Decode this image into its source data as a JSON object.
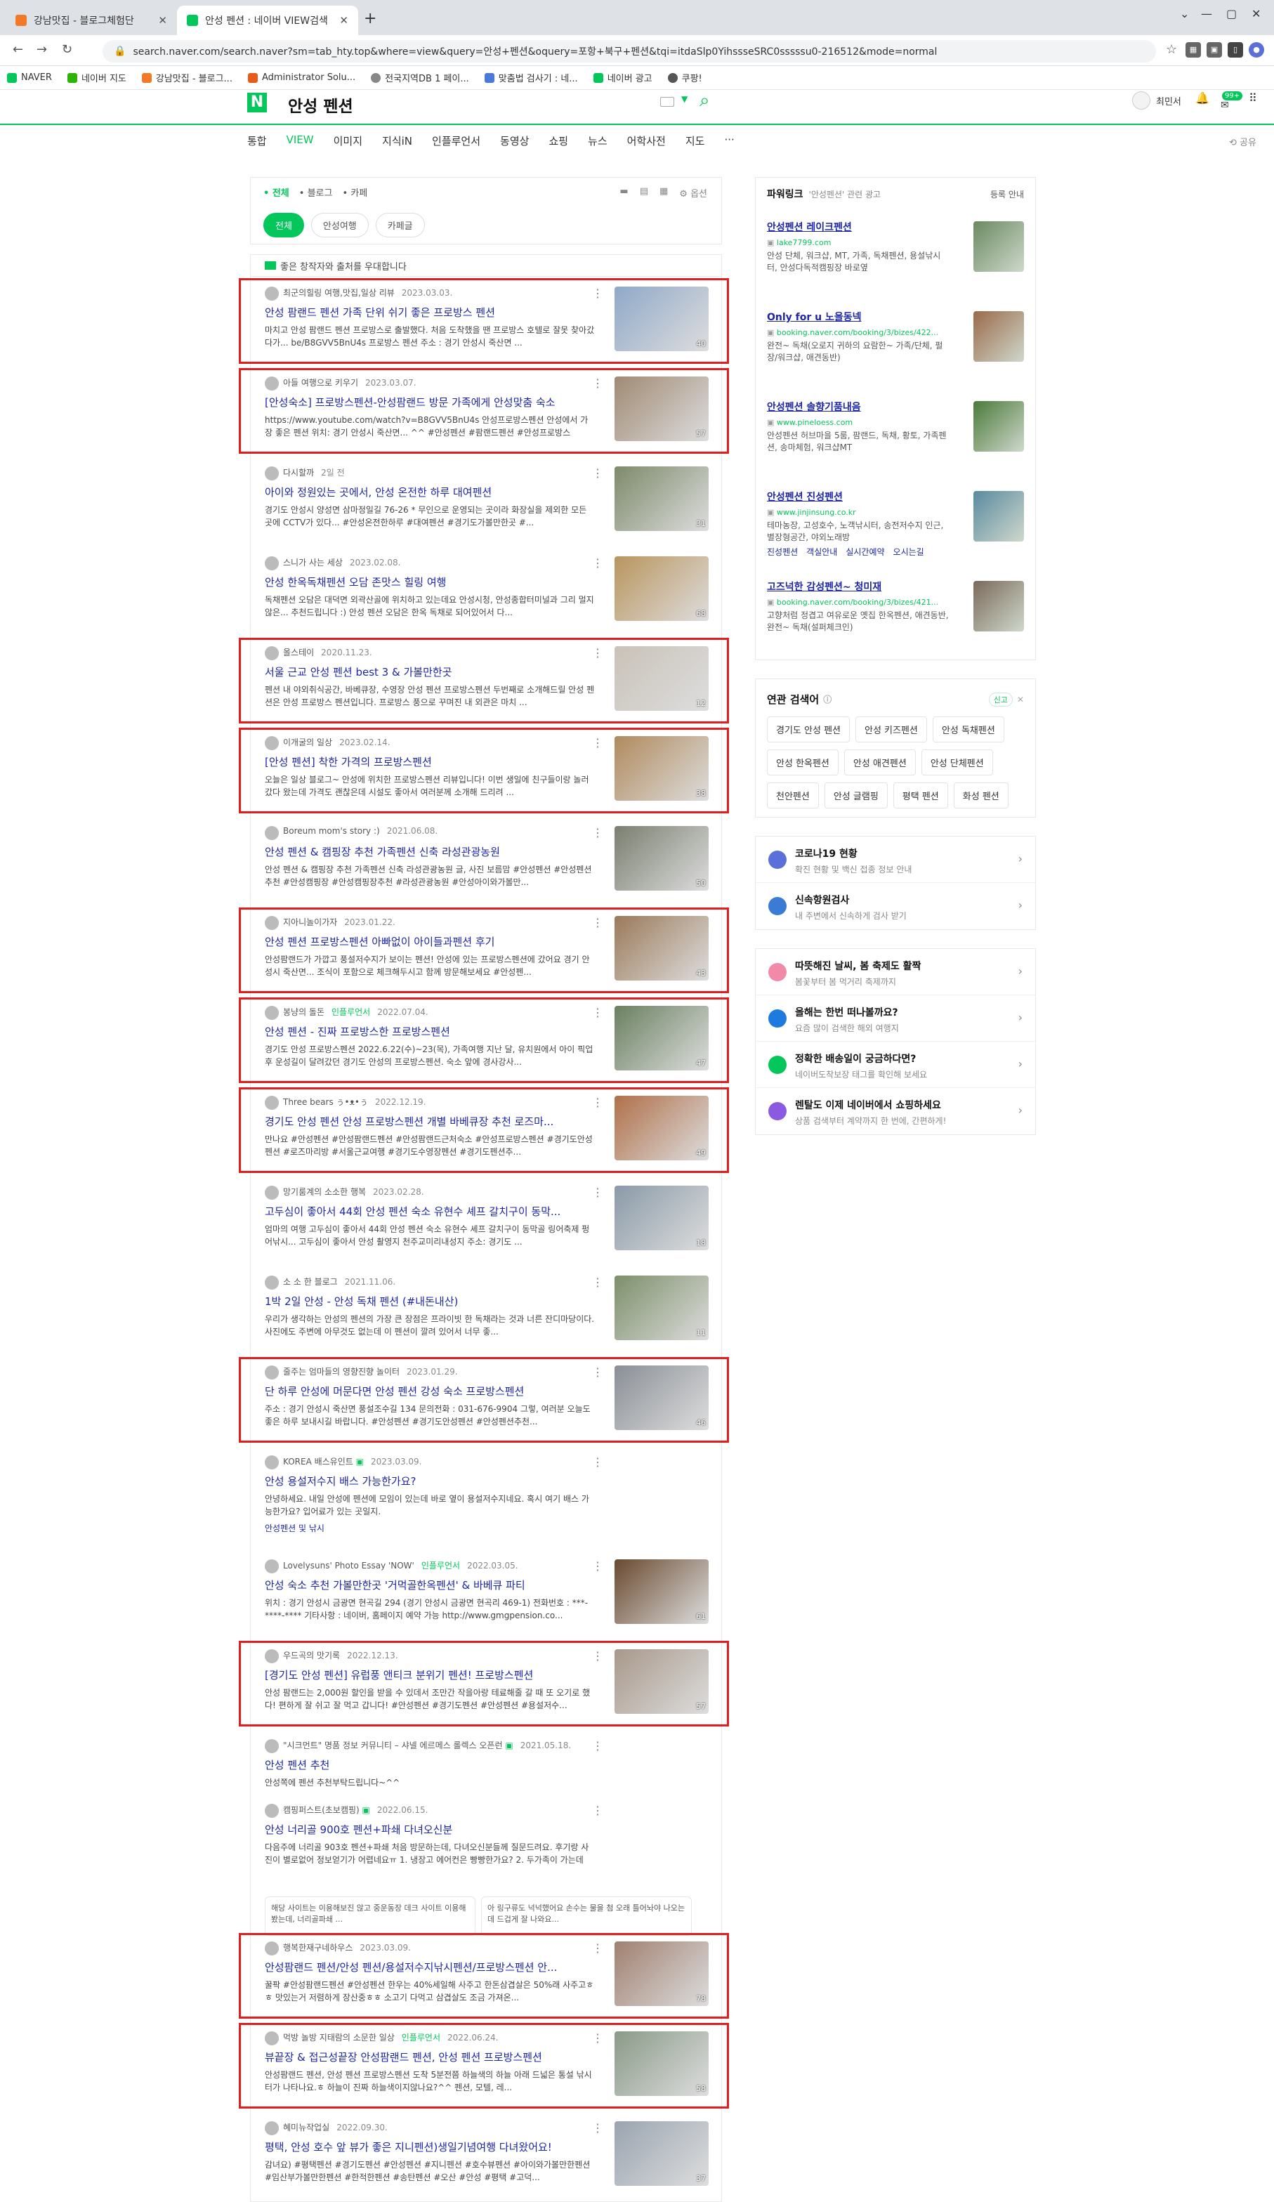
{
  "browser": {
    "tabs": [
      {
        "title": "강남맛집 - 블로그체험단",
        "active": false
      },
      {
        "title": "안성 펜션 : 네이버 VIEW검색",
        "active": true
      }
    ],
    "url": "search.naver.com/search.naver?sm=tab_hty.top&where=view&query=안성+펜션&oquery=포항+북구+펜션&tqi=itdaSlp0YihssseSRC0sssssu0-216512&mode=normal",
    "bookmarks": [
      "NAVER",
      "네이버 지도",
      "강남맛집 - 블로그...",
      "Administrator Solu...",
      "전국지역DB 1 페이...",
      "맞춤법 검사기 : 네...",
      "네이버 광고",
      "쿠팡!"
    ]
  },
  "header": {
    "logo": "N",
    "query": "안성 펜션",
    "user": "최민서",
    "badge": "99+"
  },
  "nav_tabs": [
    "통합",
    "VIEW",
    "이미지",
    "지식iN",
    "인플루언서",
    "동영상",
    "쇼핑",
    "뉴스",
    "어학사전",
    "지도",
    "···"
  ],
  "active_tab": "VIEW",
  "share": "공유",
  "filters": {
    "scopes": [
      "• 전체",
      "• 블로그",
      "• 카페"
    ],
    "options": "옵션",
    "pills": [
      "전체",
      "안성여행",
      "카페글"
    ],
    "notice": "좋은 창작자와 출처를 우대합니다"
  },
  "results": [
    {
      "author": "최군의힐링 여행,맛집,일상 리뷰",
      "date": "2023.03.03.",
      "title": "안성 팜랜드 펜션 가족 단위 쉬기 좋은 프로방스 펜션",
      "desc": "마치고 안성 팜랜드 펜션 프로방스로 출발했다. 처음 도착했을 땐 프로방스 호텔로 잘못 찾아갔다가... be/B8GVV5BnU4s 프로방스 펜션 주소 : 경기 안성시 죽산면 ...",
      "count": "40",
      "highlighted": true,
      "thumb": "#8fa8c8"
    },
    {
      "author": "아들 여행으로 키우기",
      "date": "2023.03.07.",
      "title": "[안성숙소] 프로방스펜션-안성팜랜드 방문 가족에게 안성맞춤 숙소",
      "desc": "https://www.youtube.com/watch?v=B8GVV5BnU4s 안성프로방스펜션 안성에서 가장 좋은 펜션 위치: 경기 안성시 죽산면... ^^ #안성펜션 #팜랜드펜션 #안성프로방스",
      "count": "57",
      "highlighted": true,
      "thumb": "#a08a74"
    },
    {
      "author": "다시할까",
      "date": "2일 전",
      "title": "아이와 정원있는 곳에서, 안성 온전한 하루 대여펜션",
      "desc": "경기도 안성시 양성면 삼마정일길 76-26 * 무인으로 운영되는 곳이라 화장실을 제외한 모든 곳에 CCTV가 있다... #안성온전한하루 #대여펜션 #경기도가볼만한곳 #...",
      "count": "31",
      "highlighted": false,
      "thumb": "#7d8a6a"
    },
    {
      "author": "스니가 사는 세상",
      "date": "2023.02.08.",
      "title": "안성 한옥독채펜션 오담 존맛스 힐링 여행",
      "desc": "독채펜션 오담은 대덕면 외곽산골에 위치하고 있는데요 안성시청, 안성종합터미널과 그리 멀지 않은... 추천드립니다 :) 안성 펜션 오담은 한옥 독채로 되어있어서 다...",
      "count": "68",
      "highlighted": false,
      "thumb": "#b9955e"
    },
    {
      "author": "올스테이",
      "date": "2020.11.23.",
      "title": "서울 근교 안성 펜션 best 3 & 가볼만한곳",
      "desc": "펜션 내 야외취식공간, 바베큐장, 수영장 안성 펜션 프로방스펜션 두번째로 소개해드릴 안성 펜션은 안성 프로방스 펜션입니다. 프로방스 풍으로 꾸며진 내 외관은 마치 ...",
      "count": "12",
      "highlighted": true,
      "thumb": "#c9c2b8"
    },
    {
      "author": "이개굴의 일상",
      "date": "2023.02.14.",
      "title": "[안성 펜션] 착한 가격의 프로방스펜션",
      "desc": "오늘은 일상 블로그~ 안성에 위치한 프로방스펜션 리뷰입니다! 이번 생일에 친구들이랑 놀러 갔다 왔는데 가격도 괜찮은데 시설도 좋아서 여러분께 소개해 드리려 ...",
      "count": "38",
      "highlighted": true,
      "thumb": "#b08a5e"
    },
    {
      "author": "Boreum mom's story :)",
      "date": "2021.06.08.",
      "title": "안성 펜션 & 캠핑장 추천 가족펜션 신축 라성관광농원",
      "desc": "안성 펜션 & 캠핑장 추천 가족펜션 신축 라성관광농원 글, 사진 보름맘 #안성펜션 #안성펜션추천 #안성캠핑장 #안성캠핑장추천 #라성관광농원 #안성아이와가볼만...",
      "count": "50",
      "highlighted": false,
      "thumb": "#7a7f70"
    },
    {
      "author": "지아니놀이가자",
      "date": "2023.01.22.",
      "title": "안성 펜션 프로방스펜션 아빠없이 아이들과펜션 후기",
      "desc": "안성팜랜드가 가깝고 풍설저수지가 보이는 펜션! 안성에 있는 프로방스펜션에 갔어요 경기 안성시 죽산면... 조식이 포함으로 체크해두시고 함께 방문해보세요 #안성펜...",
      "count": "43",
      "highlighted": true,
      "thumb": "#9b7a5a"
    },
    {
      "author": "봉냥의 돌돈",
      "date": "2022.07.04.",
      "influencer": "인플루언서",
      "title": "안성 펜션 - 진짜 프로방스한 프로방스펜션",
      "desc": "경기도 안성 프로방스펜션 2022.6.22(수)~23(목), 가족여행 지난 달, 유치원에서 아이 픽업 후 운성길이 달려갔던 경기도 안성의 프로방스펜션. 숙소 앞에 경사강사...",
      "count": "47",
      "highlighted": true,
      "thumb": "#6a8060"
    },
    {
      "author": "Three bears ぅ•ᴥ•ぅ",
      "date": "2022.12.19.",
      "title": "경기도 안성 펜션 안성 프로방스펜션 개별 바베큐장 추천 로즈마...",
      "desc": "만나요 #안성펜션 #안성팜랜드펜션 #안성팜랜드근처숙소 #안성프로방스펜션 #경기도안성펜션 #로즈마리방 #서울근교여행 #경기도수영장펜션 #경기도펜션추...",
      "count": "49",
      "highlighted": true,
      "thumb": "#b0704a"
    },
    {
      "author": "망기룸계의 소소한 행복",
      "date": "2023.02.28.",
      "title": "고두심이 좋아서 44회 안성 펜션 숙소 유현수 셰프 갈치구이 동막...",
      "desc": "엄마의 여행 고두심이 좋아서 44회 안성 펜션 숙소 유현수 셰프 갈치구이 동막골 링어축제 펑어낚시... 고두심이 좋아서 안성 촬영지 천주교미리내성지 주소: 경기도 ...",
      "count": "18",
      "highlighted": false,
      "thumb": "#8a9aa8"
    },
    {
      "author": "소 소 한 블로그",
      "date": "2021.11.06.",
      "title": "1박 2일 안성 - 안성 독채 펜션 (#내돈내산)",
      "desc": "우리가 생각하는 안성의 펜션의 가장 큰 장점은 프라이빗 한 독채라는 것과 너른 잔디마당이다. 사진에도 주변에 아무것도 없는데 이 펜션이 깔려 있어서 너무 좋...",
      "count": "11",
      "highlighted": false,
      "thumb": "#7d8f6a"
    },
    {
      "author": "줄주는 엄마들의 영향진향 놀이터",
      "date": "2023.01.29.",
      "title": "단 하루 안성에 머문다면 안성 펜션 강성 숙소 프로방스펜션",
      "desc": "주소 : 경기 안성시 죽산면 풍설조수길 134 문의전화 : 031-676-9904 그렇, 여러분 오늘도 좋은 하루 보내시길 바랍니다. #안성펜션 #경기도안성펜션 #안성펜션추천...",
      "count": "46",
      "highlighted": true,
      "thumb": "#8a8f96"
    },
    {
      "author": "KOREA 배스유인트",
      "date": "2023.03.09.",
      "cafe": true,
      "title": "안성 용설저수지 배스 가능한가요?",
      "desc": "안녕하세요. 내일 안성에 펜션에 모임이 있는데 바로 옆이 용설저수지네요. 혹시 여기 배스 가능한가요? 입어료가 있는 곳일지.",
      "tags": "안성펜션 및 낚시",
      "highlighted": false
    },
    {
      "author": "Lovelysuns' Photo Essay 'NOW'",
      "date": "2022.03.05.",
      "influencer": "인플루언서",
      "title": "안성 숙소 추천 가볼만한곳 '거먹골한옥펜션' & 바베큐 파티",
      "desc": "위치 : 경기 안성시 금광면 현곡길 294 (경기 안성시 금광면 현곡리 469-1) 전화번호 : ***-****-**** 기타사항 : 네이버, 홈페이지 예약 가능 http://www.gmgpension.co...",
      "count": "61",
      "highlighted": false,
      "thumb": "#6a4a30"
    },
    {
      "author": "우드곡의 맛기록",
      "date": "2022.12.13.",
      "title": "[경기도 안성 펜션] 유럽풍 앤티크 분위기 펜션! 프로방스펜션",
      "desc": "안성 팜랜드는 2,000원 할인을 받을 수 있데서 조만간 작을아랑 테료해줄 갈 때 또 오기로 했다! 편하게 잘 쉬고 잘 먹고 갑니다! #안성펜션 #경기도펜션 #안성펜션 #용설저수...",
      "count": "57",
      "highlighted": true,
      "thumb": "#a8988a"
    },
    {
      "author": "\"시크먼트\" 명품 정보 커뮤니티 – 샤넬 에르메스 롤렉스 오픈런",
      "date": "2021.05.18.",
      "cafe": true,
      "title": "안성 펜션 추천",
      "desc": "안성쪽에 펜션 추천부탁드립니다~^^",
      "highlighted": false
    },
    {
      "author": "캠핑퍼스트(초보캠핑)",
      "date": "2022.06.15.",
      "cafe": true,
      "title": "안성 너리골 900호 펜션+파쇄 다녀오신분",
      "desc": "다음주에 너리골 903호 펜션+파쇄 처음 방문하는데, 다녀오신분들께 질문드려요. 후기랑 사진이 별로없어 정보얻기가 어렵네요ㅠ 1. 냉장고 에어컨은 빵빵한가요? 2. 두가족이 가는데 (성인4 아이4) 펜션안에서 몇명이...",
      "sub": [
        "해당 사이트는 이용해보진 않고 중운동장 데크 사이트 이용해봤는데, 너리골파쇄 ...",
        "아 링구류도 넉넉했어요 손수는 물을 첨 오래 틀어놔야 나오는데 드겁게 잘 나와요..."
      ],
      "highlighted": false
    },
    {
      "author": "행복한재구네하우스",
      "date": "2023.03.09.",
      "title": "안성팜랜드 펜션/안성 펜션/용설저수지낚시펜션/프로방스펜션 안...",
      "desc": "꿀팍 #안성팜랜드펜션 #안성펜션 한우는 40%세일해 사주고 한돈삼겹살은 50%래 사주고ㅎㅎ 맛있는거 저렴하게 장산중ㅎㅎ 소고기 다먹고 삼겹살도 조금 가져온...",
      "count": "78",
      "highlighted": true,
      "thumb": "#a08070"
    },
    {
      "author": "먹방 놀방 지태람의 소문한 일상",
      "date": "2022.06.24.",
      "influencer": "인플루언서",
      "title": "뷰끝장 & 접근성끝장 안성팜랜드 펜션, 안성 펜션 프로방스펜션",
      "desc": "안성팜랜드 펜션, 안성 펜션 프로방스펜션 도착 5분전쯤 하늘색의 하늘 아래 드넓은 통설 낚시터가 나타나요.ㅎ 하늘이 진짜 하늘색이지않나요?^^ 펜션, 모텔, 레...",
      "count": "58",
      "highlighted": true,
      "thumb": "#8a9a88"
    },
    {
      "author": "혜미뉴작업실",
      "date": "2022.09.30.",
      "title": "평택, 안성 호수 앞 뷰가 좋은 지니펜션)생일기념여행 다녀왔어요!",
      "desc": "감녀요) #평택펜션 #경기도펜션 #안성펜션 #지니펜션 #호수뷰펜션 #아이와가볼만한펜션 #임산부가볼만한펜션 #한적한펜션 #송탄펜션 #오산 #안성 #평택 #고덕...",
      "count": "37",
      "highlighted": false,
      "thumb": "#9aa4b0"
    }
  ],
  "sidebar": {
    "powerlink": {
      "title": "파워링크",
      "sub": "'안성펜션' 관련 광고",
      "info": "등록 안내"
    },
    "ads": [
      {
        "title": "안성펜션 레이크펜션",
        "url": "lake7799.com",
        "desc": "안성 단체, 워크샵, MT, 가족, 독채펜션, 용설낚시터, 안성다독적캠핑장 바로옆",
        "thumb": "#6a8a60"
      },
      {
        "title": "Only for u 노을동넥",
        "url": "booking.naver.com/booking/3/bizes/422...",
        "desc": "완전~ 독채(오로지 귀하의 요람한~ 가족/단체, 펄장/워크샵, 애견동반)",
        "thumb": "#9a6a4a"
      },
      {
        "title": "안성펜션 솔향기품내음",
        "url": "www.pineloess.com",
        "desc": "안성펜션 허브마을 5룸, 팜랜드, 독채, 황토, 가족펜션, 송마체험, 워크샵MT",
        "thumb": "#4a7a3a"
      },
      {
        "title": "안성펜션 진성펜션",
        "url": "www.jinjinsung.co.kr",
        "desc": "테마농장, 고성호수, 노객낚시터, 송전저수지 인근, 별장형공간, 야외노래방",
        "links": [
          "진성펜션",
          "객실안내",
          "실시간예약",
          "오시는길"
        ],
        "thumb": "#5a8aa0"
      },
      {
        "title": "고즈넉한 감성펜션~ 청미재",
        "url": "booking.naver.com/booking/3/bizes/421...",
        "desc": "고향처럼 정겹고 여유로운 옛집 한옥펜션, 애견동반, 완전~ 독채(설퍼체크인)",
        "thumb": "#7a6a5a"
      }
    ],
    "related": {
      "title": "연관 검색어",
      "toggle": "신고",
      "chips": [
        "경기도 안성 펜션",
        "안성 키즈펜션",
        "안성 독채펜션",
        "안성 한옥펜션",
        "안성 애견펜션",
        "안성 단체펜션",
        "천안펜션",
        "안성 글램핑",
        "평택 펜션",
        "화성 펜션"
      ]
    },
    "links1": [
      {
        "title": "코로나19 현황",
        "sub": "확진 현황 및 백신 접종 정보 안내",
        "color": "#5b6fd8"
      },
      {
        "title": "신속항원검사",
        "sub": "내 주변에서 신속하게 검사 받기",
        "color": "#3a7bd5"
      }
    ],
    "links2": [
      {
        "title": "따뜻해진 날씨, 봄 축제도 활짝",
        "sub": "봄꽃부터 봄 먹거리 축제까지",
        "color": "#f08aa8"
      },
      {
        "title": "올해는 한번 떠나볼까요?",
        "sub": "요즘 많이 검색한 해외 여행지",
        "color": "#1f7ae0"
      },
      {
        "title": "정확한 배송일이 궁금하다면?",
        "sub": "네이버도착보장 태그를 확인해 보세요",
        "color": "#03c75a"
      },
      {
        "title": "렌탈도 이제 네이버에서 쇼핑하세요",
        "sub": "상품 검색부터 계약까지 한 번에, 간편하게!",
        "color": "#8a5ae0"
      }
    ]
  }
}
